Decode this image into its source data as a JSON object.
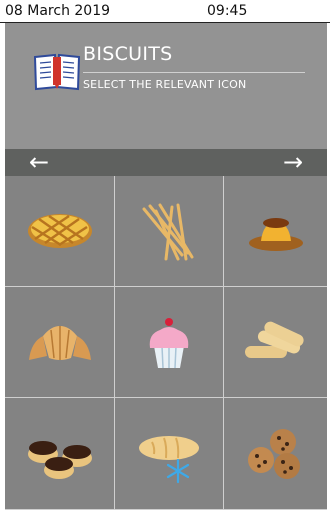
{
  "status_bar": {
    "date": "08 March 2019",
    "time": "09:45"
  },
  "header": {
    "title": "BISCUITS",
    "subtitle": "SELECT THE RELEVANT ICON",
    "icon": "open-book-icon"
  },
  "nav": {
    "prev_arrow": "←",
    "next_arrow": "→"
  },
  "grid_icons": [
    "pie-icon",
    "breadsticks-icon",
    "flan-icon",
    "croissant-icon",
    "cupcake-icon",
    "ladyfingers-icon",
    "eclairs-icon",
    "frozen-bread-icon",
    "cookies-icon"
  ]
}
